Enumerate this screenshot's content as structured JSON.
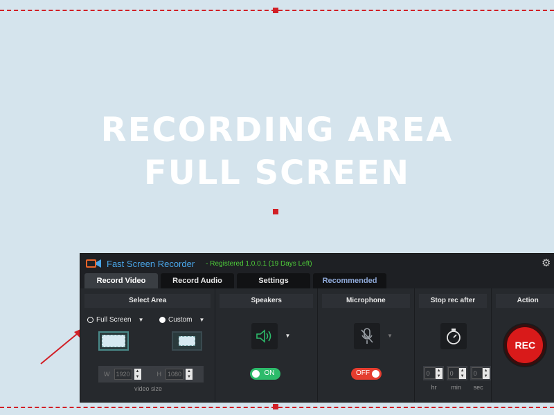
{
  "overlay": {
    "line1": "RECORDING AREA",
    "line2": "FULL SCREEN",
    "accent": "#d11f26"
  },
  "app": {
    "title": "Fast Screen Recorder",
    "registered": "- Registered 1.0.0.1 (19 Days Left)",
    "icons": [
      "settings-gear-icon",
      "close-icon"
    ]
  },
  "tabs": [
    {
      "label": "Record Video",
      "active": true
    },
    {
      "label": "Record Audio",
      "active": false
    },
    {
      "label": "Settings",
      "active": false
    },
    {
      "label": "Recommended",
      "active": false
    }
  ],
  "select_area": {
    "header": "Select Area",
    "full_screen": "Full Screen",
    "custom": "Custom",
    "selected": "Full Screen",
    "width_label": "W",
    "width_value": "1920",
    "height_label": "H",
    "height_value": "1080",
    "caption": "video size"
  },
  "speakers": {
    "header": "Speakers",
    "toggle": "ON",
    "state": "on"
  },
  "microphone": {
    "header": "Microphone",
    "toggle": "OFF",
    "state": "off"
  },
  "stop_rec": {
    "header": "Stop rec after",
    "hr": "0",
    "min": "0",
    "sec": "0",
    "hr_label": "hr",
    "min_label": "min",
    "sec_label": "sec"
  },
  "action": {
    "header": "Action",
    "rec_label": "REC"
  }
}
